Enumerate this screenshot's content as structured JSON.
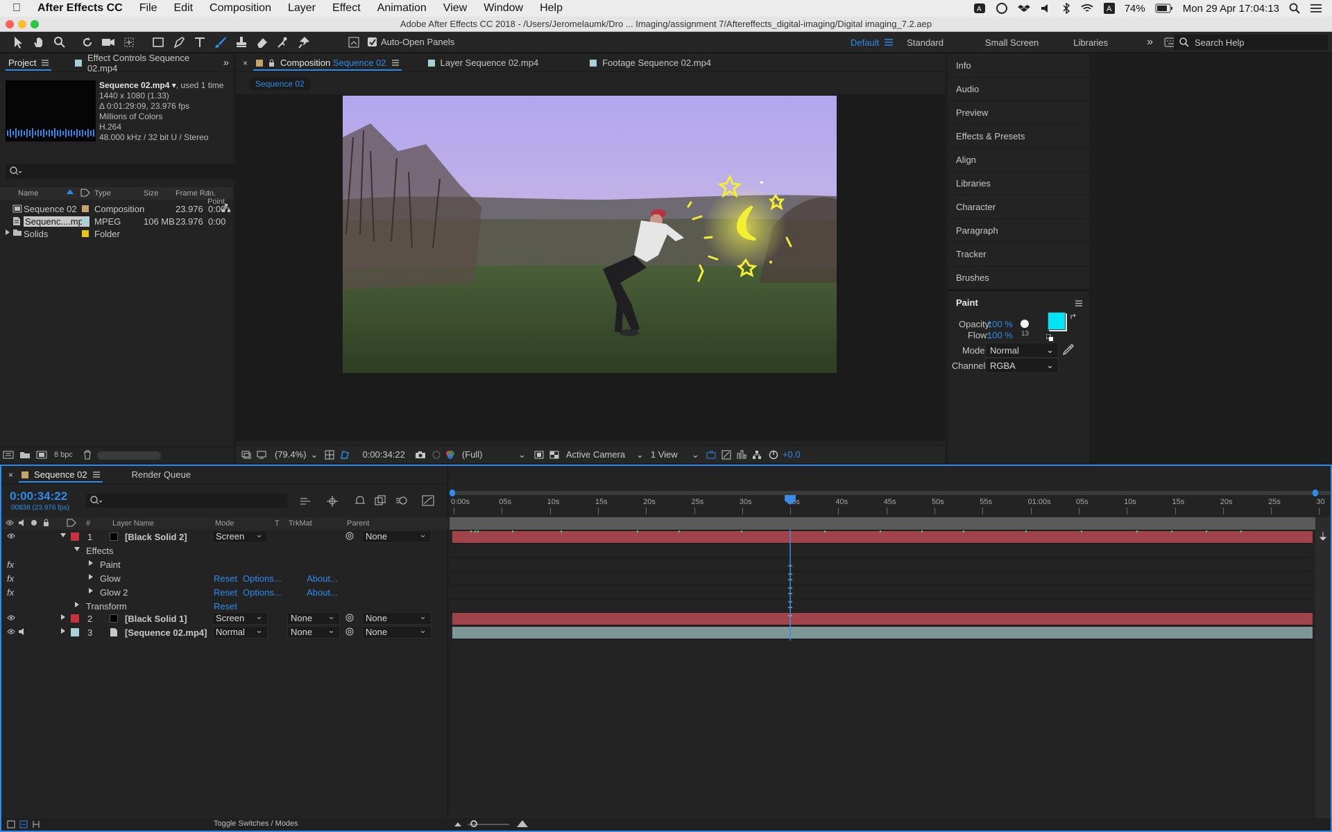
{
  "menubar": {
    "app": "After Effects CC",
    "items": [
      "File",
      "Edit",
      "Composition",
      "Layer",
      "Effect",
      "Animation",
      "View",
      "Window",
      "Help"
    ],
    "battery": "74%",
    "clock": "Mon 29 Apr  17:04:13"
  },
  "window": {
    "title": "Adobe After Effects CC 2018 - /Users/Jeromelaumk/Dro ... Imaging/assignment 7/Aftereffects_digital-imaging/Digital imaging_7.2.aep"
  },
  "toolbar": {
    "auto_open": "Auto-Open Panels",
    "workspaces": [
      "Default",
      "Standard",
      "Small Screen",
      "Libraries"
    ],
    "search_placeholder": "Search Help"
  },
  "project": {
    "tab_project": "Project",
    "tab_effect_controls": "Effect Controls Sequence 02.mp4",
    "footage_name": "Sequence 02.mp4 ▾",
    "footage_used": ", used 1 time",
    "footage_dims": "1440 x 1080 (1.33)",
    "footage_duration": "Δ 0:01:29:09, 23.976 fps",
    "footage_colors": "Millions of Colors",
    "footage_codec": "H.264",
    "footage_audio": "48.000 kHz / 32 bit U / Stereo",
    "columns": [
      "Name",
      "Type",
      "Size",
      "Frame Ra...",
      "In Point"
    ],
    "items": [
      {
        "name": "Sequence 02",
        "type": "Composition",
        "size": "",
        "fps": "23.976",
        "in": "0:00",
        "color": "#c4a46a"
      },
      {
        "name": "Sequenc....mp4",
        "type": "MPEG",
        "size": "106 MB",
        "fps": "23.976",
        "in": "0:00",
        "color": "#a9d2d8"
      },
      {
        "name": "Solids",
        "type": "Folder",
        "size": "",
        "fps": "",
        "in": "",
        "color": "#e6c414"
      }
    ],
    "bpc": "8 bpc"
  },
  "composition": {
    "tab_comp_prefix": "Composition",
    "tab_comp_name": "Sequence 02",
    "tab_layer": "Layer Sequence 02.mp4",
    "tab_footage": "Footage Sequence 02.mp4",
    "subtab": "Sequence 02",
    "zoom": "(79.4%)",
    "timecode": "0:00:34:22",
    "resolution": "(Full)",
    "camera": "Active Camera",
    "view": "1 View",
    "exposure": "+0.0"
  },
  "right_panel": {
    "items": [
      "Info",
      "Audio",
      "Preview",
      "Effects & Presets",
      "Align",
      "Libraries",
      "Character",
      "Paragraph",
      "Tracker",
      "Brushes"
    ],
    "paint_title": "Paint",
    "opacity_label": "Opacity:",
    "opacity_value": "100 %",
    "flow_label": "Flow:",
    "flow_value": "100 %",
    "brush_size": "13",
    "mode_label": "Mode:",
    "mode_value": "Normal",
    "channels_label": "Channels:",
    "channels_value": "RGBA",
    "fg_color": "#00e5f5",
    "bg_color": "#ffffff"
  },
  "timeline": {
    "tab_comp": "Sequence 02",
    "tab_render": "Render Queue",
    "timecode": "0:00:34:22",
    "frame_info": "00838 (23.976 fps)",
    "columns": {
      "num": "#",
      "name": "Layer Name",
      "mode": "Mode",
      "t": "T",
      "trkmat": "TrkMat",
      "parent": "Parent"
    },
    "layers": [
      {
        "num": "1",
        "name": "[Black Solid 2]",
        "mode": "Screen",
        "trkmat": "",
        "parent": "None"
      },
      {
        "num": "2",
        "name": "[Black Solid 1]",
        "mode": "Screen",
        "trkmat": "None",
        "parent": "None"
      },
      {
        "num": "3",
        "name": "[Sequence 02.mp4]",
        "mode": "Normal",
        "trkmat": "None",
        "parent": "None"
      }
    ],
    "effects_label": "Effects",
    "effects": [
      {
        "name": "Paint",
        "reset": "",
        "options": "",
        "about": ""
      },
      {
        "name": "Glow",
        "reset": "Reset",
        "options": "Options...",
        "about": "About..."
      },
      {
        "name": "Glow 2",
        "reset": "Reset",
        "options": "Options...",
        "about": "About..."
      }
    ],
    "transform_label": "Transform",
    "transform_reset": "Reset",
    "ruler": [
      "0:00s",
      "05s",
      "10s",
      "15s",
      "20s",
      "25s",
      "30s",
      "35s",
      "40s",
      "45s",
      "50s",
      "55s",
      "01:00s",
      "05s",
      "10s",
      "15s",
      "20s",
      "25s",
      "30"
    ],
    "playhead_label": "35s",
    "toggle": "Toggle Switches / Modes",
    "colors": {
      "solid": "#a0434b",
      "footage": "#7e9696",
      "playhead": "#3a8ee6"
    }
  }
}
